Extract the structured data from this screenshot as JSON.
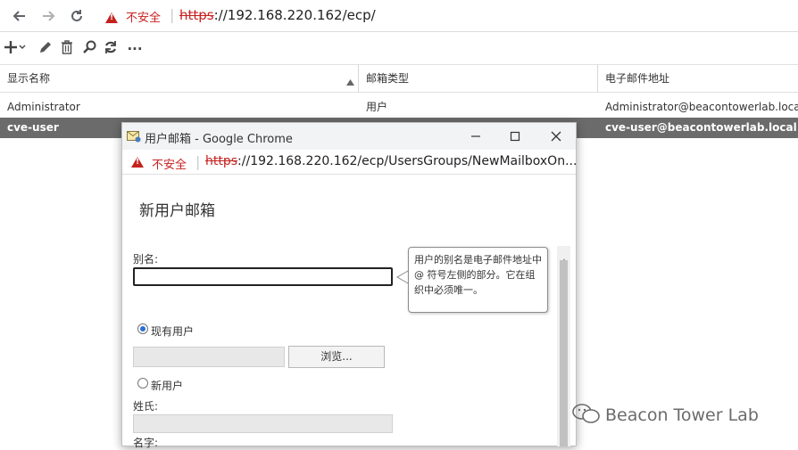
{
  "browser": {
    "insecure_label": "不安全",
    "url_scheme": "https",
    "url_rest": "://192.168.220.162/ecp/"
  },
  "toolbar": {
    "more_label": "..."
  },
  "grid": {
    "headers": [
      "显示名称",
      "邮箱类型",
      "电子邮件地址"
    ],
    "rows": [
      {
        "name": "Administrator",
        "type": "用户",
        "email": "Administrator@beacontowerlab.local"
      },
      {
        "name": "cve-user",
        "type": "",
        "email": "cve-user@beacontowerlab.local"
      }
    ]
  },
  "popup": {
    "window_title": "用户邮箱 - Google Chrome",
    "insecure_label": "不安全",
    "url_scheme": "https",
    "url_rest": "://192.168.220.162/ecp/UsersGroups/NewMailboxOn...",
    "heading": "新用户邮箱",
    "alias_label": "别名:",
    "alias_value": "",
    "existing_user_label": "现有用户",
    "browse_label": "浏览...",
    "new_user_label": "新用户",
    "lastname_label": "姓氏:",
    "firstname_label": "名字:",
    "tooltip_text": "用户的别名是电子邮件地址中 @ 符号左侧的部分。它在组织中必须唯一。"
  },
  "watermark": "Beacon Tower Lab",
  "colors": {
    "warning": "#c5221f",
    "selected_row": "#6b6b6b",
    "radio_accent": "#2b6fd6"
  },
  "icons": [
    "back-arrow-icon",
    "forward-arrow-icon",
    "reload-icon",
    "warning-icon",
    "add-icon",
    "edit-pencil-icon",
    "delete-trash-icon",
    "search-icon",
    "refresh-icon",
    "more-icon",
    "sort-asc-icon",
    "minimize-icon",
    "maximize-icon",
    "close-icon",
    "wechat-icon"
  ]
}
